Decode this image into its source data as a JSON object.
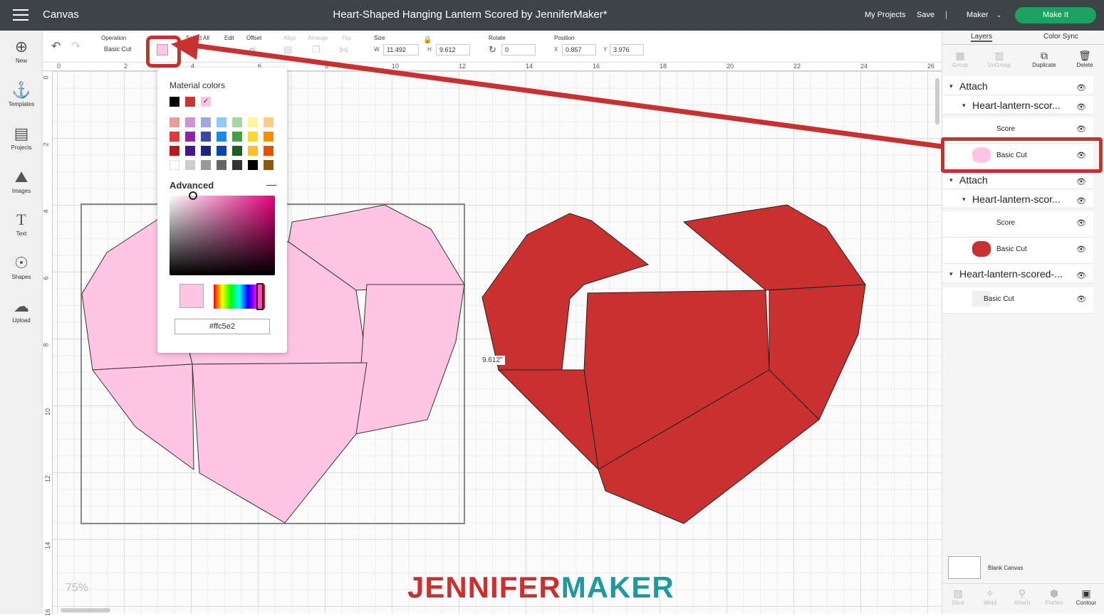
{
  "topbar": {
    "app_name": "Canvas",
    "doc_title": "Heart-Shaped Hanging Lantern Scored by JenniferMaker*",
    "my_projects": "My Projects",
    "save": "Save",
    "separator": "|",
    "machine": "Maker",
    "make_it": "Make It"
  },
  "leftbar": {
    "items": [
      {
        "label": "New",
        "icon": "plus-icon"
      },
      {
        "label": "Templates",
        "icon": "shirt-icon"
      },
      {
        "label": "Projects",
        "icon": "projects-icon"
      },
      {
        "label": "Images",
        "icon": "image-icon"
      },
      {
        "label": "Text",
        "icon": "text-icon"
      },
      {
        "label": "Shapes",
        "icon": "shapes-icon"
      },
      {
        "label": "Upload",
        "icon": "upload-icon"
      }
    ]
  },
  "toolbar": {
    "operation_label": "Operation",
    "operation_value": "Basic Cut",
    "select_all": "Select All",
    "edit": "Edit",
    "offset": "Offset",
    "align": "Align",
    "arrange": "Arrange",
    "flip": "Flip",
    "size": "Size",
    "w_label": "W",
    "w_value": "11.492",
    "h_label": "H",
    "h_value": "9.612",
    "rotate": "Rotate",
    "rotate_value": "0",
    "position": "Position",
    "x_label": "X",
    "x_value": "0.857",
    "y_label": "Y",
    "y_value": "3.976",
    "current_color": "#ffc5e2"
  },
  "ruler": {
    "top": [
      "0",
      "2",
      "4",
      "6",
      "8",
      "10",
      "12",
      "14",
      "16",
      "18",
      "20",
      "22",
      "24",
      "26"
    ],
    "left": [
      "0",
      "2",
      "4",
      "6",
      "8",
      "10",
      "12",
      "14",
      "16"
    ]
  },
  "color_popover": {
    "title": "Material colors",
    "material": [
      "#000000",
      "#cc3333",
      "#ffc5e2"
    ],
    "palette": [
      [
        "#ef9a9a",
        "#ce93d8",
        "#9fa8da",
        "#90caf9",
        "#a5d6a7",
        "#fff59d",
        "#ffcc80"
      ],
      [
        "#e53935",
        "#8e24aa",
        "#3949ab",
        "#1e88e5",
        "#43a047",
        "#fdd835",
        "#fb8c00"
      ],
      [
        "#b71c1c",
        "#4a148c",
        "#1a237e",
        "#0d47a1",
        "#1b5e20",
        "#fbc02d",
        "#e65100"
      ],
      [
        "#ffffff",
        "#cccccc",
        "#999999",
        "#666666",
        "#333333",
        "#000000",
        "#8d5a00"
      ]
    ],
    "advanced": "Advanced",
    "minus": "—",
    "hex": "#ffc5e2",
    "hex_display": "#ffc5e2"
  },
  "canvas": {
    "dimension_label": "9.612\"",
    "zoom": "75%",
    "brand_a": "JENNIFER",
    "brand_b": "MAKER",
    "pink": "#ffc5e2",
    "red": "#c93030"
  },
  "rightbar": {
    "tab_layers": "Layers",
    "tab_color_sync": "Color Sync",
    "tools": [
      "Group",
      "UnGroup",
      "Duplicate",
      "Delete"
    ],
    "layers": [
      {
        "type": "group",
        "name": "Attach"
      },
      {
        "type": "subgroup",
        "name": "Heart-lantern-scor..."
      },
      {
        "type": "item",
        "name": "Score"
      },
      {
        "type": "item",
        "name": "Basic Cut"
      },
      {
        "type": "group",
        "name": "Attach"
      },
      {
        "type": "subgroup",
        "name": "Heart-lantern-scor..."
      },
      {
        "type": "item",
        "name": "Score"
      },
      {
        "type": "item",
        "name": "Basic Cut"
      },
      {
        "type": "group",
        "name": "Heart-lantern-scored-..."
      },
      {
        "type": "item",
        "name": "Basic Cut"
      }
    ],
    "blank_canvas": "Blank Canvas",
    "bottom_tools": [
      "Slice",
      "Weld",
      "Attach",
      "Flatten",
      "Contour"
    ]
  }
}
